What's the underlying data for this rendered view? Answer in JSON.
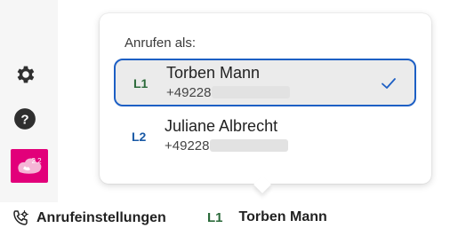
{
  "sidebar": {
    "icons": [
      "gear-icon",
      "help-icon",
      "app-icon"
    ],
    "app_badge": "2.2",
    "app_color": "#e2007a"
  },
  "popover": {
    "title": "Anrufen als:",
    "options": [
      {
        "code": "L1",
        "name": "Torben Mann",
        "number": "+49228",
        "selected": true
      },
      {
        "code": "L2",
        "name": "Juliane Albrecht",
        "number": "+49228",
        "selected": false
      }
    ]
  },
  "bottom_bar": {
    "call_settings_label": "Anrufeinstellungen",
    "current_line_code": "L1",
    "current_line_name": "Torben Mann"
  },
  "colors": {
    "accent": "#1d5fc4",
    "line1": "#2b6a3a",
    "line2": "#1a5aa6"
  }
}
